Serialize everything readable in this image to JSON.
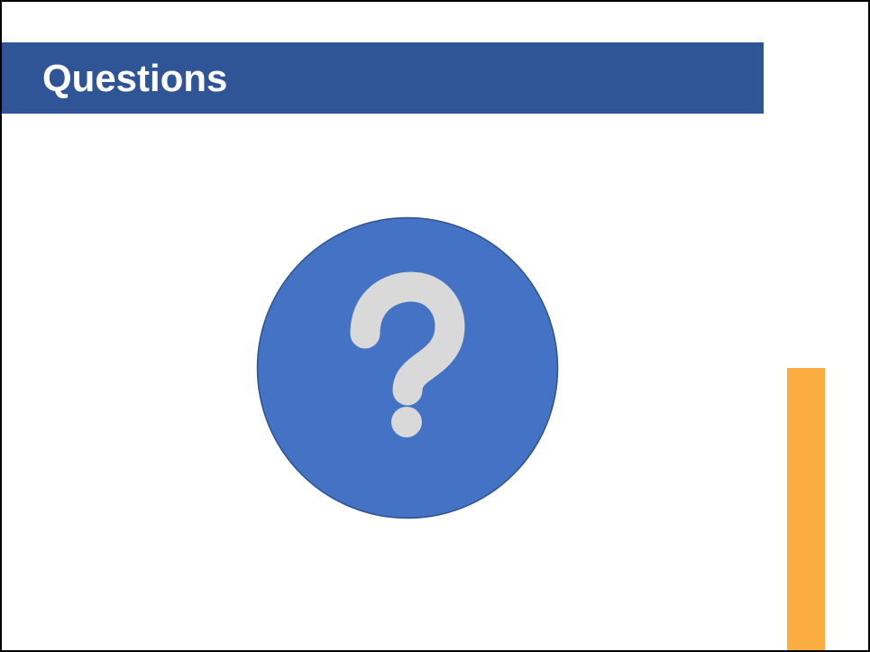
{
  "slide": {
    "title": "Questions",
    "icon": "question-mark-circle-icon"
  },
  "colors": {
    "title_bar": "#2f5597",
    "title_text": "#ffffff",
    "circle_fill": "#4472c4",
    "circle_stroke": "#2f528f",
    "question_mark": "#d9d9d9",
    "accent_bar": "#fbad41"
  }
}
